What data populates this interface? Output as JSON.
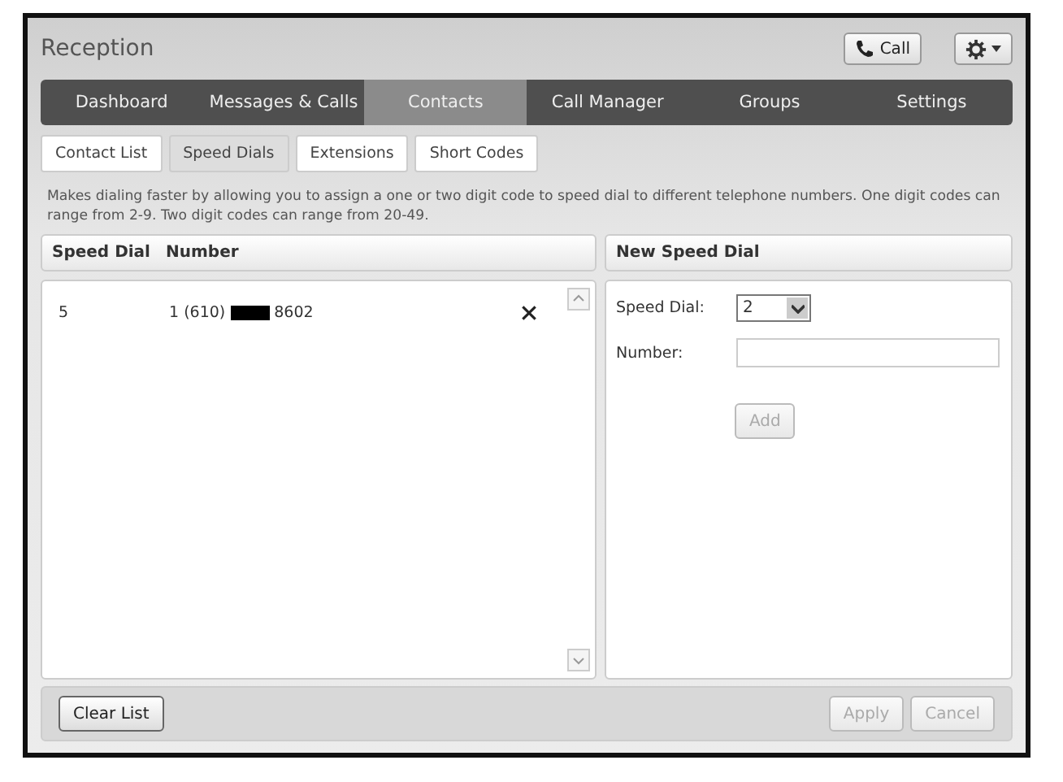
{
  "window": {
    "title": "Reception"
  },
  "header_buttons": [
    {
      "kind": "call",
      "label": "Call"
    },
    {
      "kind": "settings"
    }
  ],
  "nav_tabs": [
    {
      "label": "Dashboard",
      "selected": false
    },
    {
      "label": "Messages & Calls",
      "selected": false
    },
    {
      "label": "Contacts",
      "selected": true
    },
    {
      "label": "Call Manager",
      "selected": false
    },
    {
      "label": "Groups",
      "selected": false
    },
    {
      "label": "Settings",
      "selected": false
    }
  ],
  "sub_tabs": [
    {
      "label": "Contact List",
      "selected": false
    },
    {
      "label": "Speed Dials",
      "selected": true
    },
    {
      "label": "Extensions",
      "selected": false
    },
    {
      "label": "Short Codes",
      "selected": false
    }
  ],
  "description": "Makes dialing faster by allowing you to assign a one or two digit code to speed dial to different telephone numbers. One digit codes can range from 2-9. Two digit codes can range from 20-49.",
  "list": {
    "columns": [
      "Speed Dial",
      "Number"
    ],
    "rows": [
      {
        "speed_dial": "5",
        "number_prefix": "1 (610)",
        "number_suffix": "8602",
        "redacted": true
      }
    ]
  },
  "new_speed_dial": {
    "title": "New Speed Dial",
    "speed_dial_label": "Speed Dial:",
    "speed_dial_value": "2",
    "number_label": "Number:",
    "add": {
      "label": "Add",
      "disabled": true
    }
  },
  "footer": {
    "clear": {
      "label": "Clear List",
      "disabled": false
    },
    "apply": {
      "label": "Apply",
      "disabled": true
    },
    "cancel": {
      "label": "Cancel",
      "disabled": true
    }
  }
}
